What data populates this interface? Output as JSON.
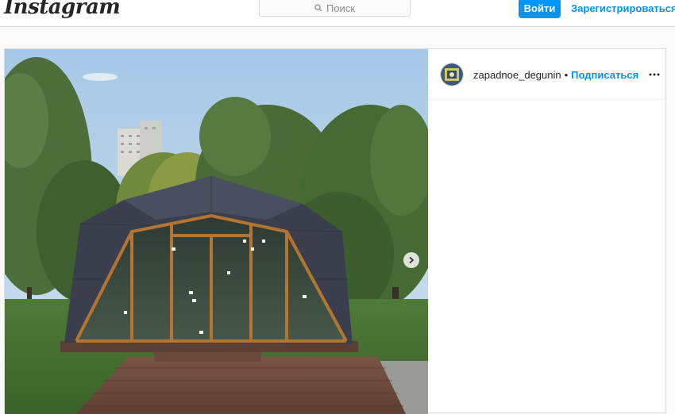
{
  "header": {
    "logo_text": "Instagram",
    "search_placeholder": "Поиск",
    "login_label": "Войти",
    "signup_label": "Зарегистрироваться"
  },
  "post": {
    "username": "zapadnoe_degunin",
    "separator": "•",
    "follow_label": "Подписаться",
    "icons": {
      "search": "search-icon",
      "more": "more-options-icon",
      "next": "chevron-right-icon",
      "avatar": "profile-avatar"
    }
  },
  "colors": {
    "accent": "#0095f6",
    "border": "#dbdbdb",
    "background": "#fafafa"
  }
}
